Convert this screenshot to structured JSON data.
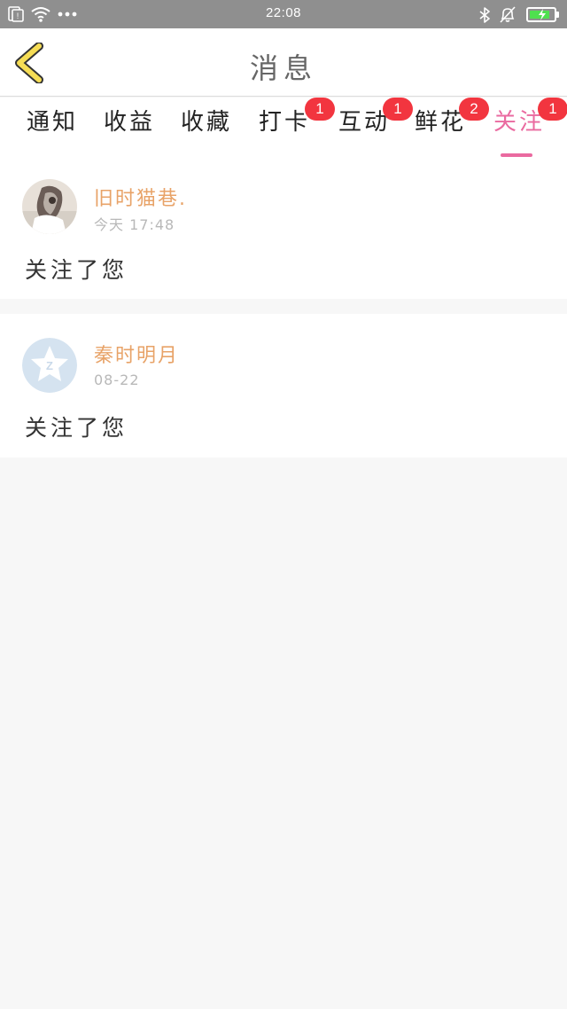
{
  "status_bar": {
    "time": "22:08",
    "icons": [
      "sim-icon",
      "wifi-icon",
      "more-dots-icon",
      "bluetooth-icon",
      "silent-bell-icon",
      "battery-charging-icon"
    ],
    "battery_level": 0.85,
    "battery_color": "#4fe04f"
  },
  "header": {
    "title": "消息",
    "back_icon": "chevron-left-icon",
    "back_icon_color": "#f6dd55"
  },
  "tabs": [
    {
      "label": "通知",
      "badge": ""
    },
    {
      "label": "收益",
      "badge": ""
    },
    {
      "label": "收藏",
      "badge": ""
    },
    {
      "label": "打卡",
      "badge": "1"
    },
    {
      "label": "互动",
      "badge": "1"
    },
    {
      "label": "鲜花",
      "badge": "2"
    },
    {
      "label": "关注",
      "badge": "1",
      "active": true
    }
  ],
  "messages": [
    {
      "name": "旧时猫巷.",
      "time": "今天 17:48",
      "content": "关注了您",
      "avatar": "photo-avatar"
    },
    {
      "name": "秦时明月",
      "time": "08-22",
      "content": "关注了您",
      "avatar": "default-qzone-avatar"
    }
  ],
  "colors": {
    "accent": "#ea6aa0",
    "badge": "#f2353f",
    "username": "#e8a368",
    "background": "#f7f7f7"
  }
}
